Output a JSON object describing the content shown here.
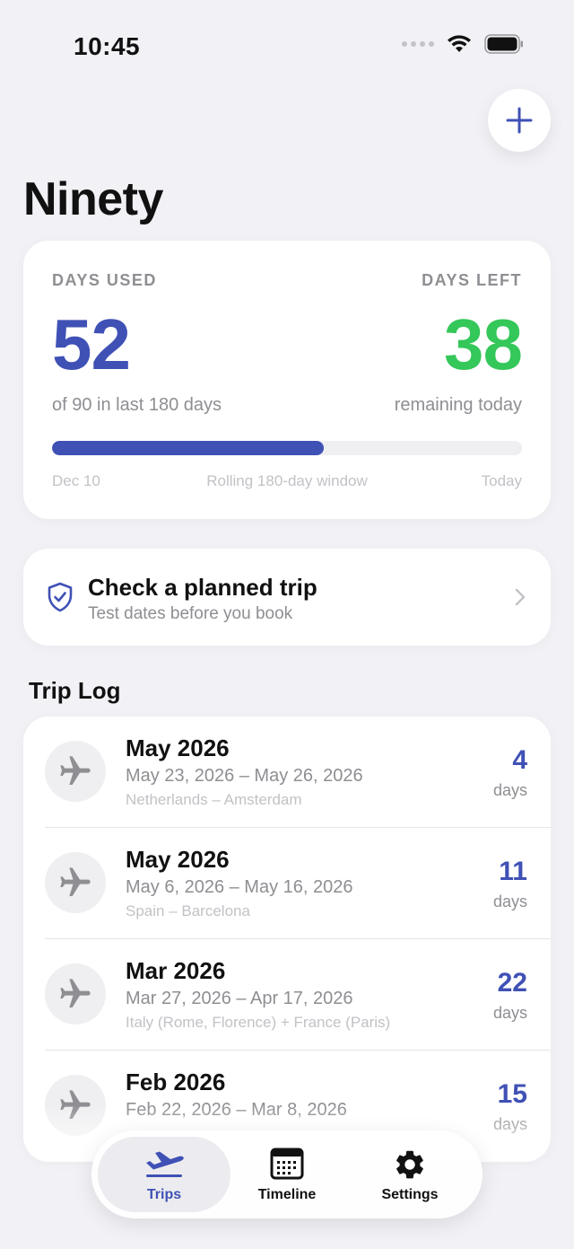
{
  "status": {
    "time": "10:45"
  },
  "header": {
    "title": "Ninety"
  },
  "summary": {
    "days_used_label": "DAYS USED",
    "days_used": "52",
    "days_used_sub": "of 90 in last 180 days",
    "days_left_label": "DAYS LEFT",
    "days_left": "38",
    "days_left_sub": "remaining today",
    "progress_fraction": 0.578,
    "window_start": "Dec 10",
    "window_label": "Rolling 180-day window",
    "window_end": "Today"
  },
  "check": {
    "title": "Check a planned trip",
    "subtitle": "Test dates before you book"
  },
  "trip_log": {
    "title": "Trip Log",
    "days_label": "days",
    "trips": [
      {
        "month": "May 2026",
        "range": "May 23, 2026 – May 26, 2026",
        "place": "Netherlands – Amsterdam",
        "days": "4"
      },
      {
        "month": "May 2026",
        "range": "May 6, 2026 – May 16, 2026",
        "place": "Spain – Barcelona",
        "days": "11"
      },
      {
        "month": "Mar 2026",
        "range": "Mar 27, 2026 – Apr 17, 2026",
        "place": "Italy (Rome, Florence) + France (Paris)",
        "days": "22"
      },
      {
        "month": "Feb 2026",
        "range": "Feb 22, 2026 – Mar 8, 2026",
        "place": "",
        "days": "15"
      }
    ]
  },
  "tabs": [
    {
      "label": "Trips",
      "icon": "airplane-takeoff-icon",
      "active": true
    },
    {
      "label": "Timeline",
      "icon": "calendar-icon",
      "active": false
    },
    {
      "label": "Settings",
      "icon": "gear-icon",
      "active": false
    }
  ],
  "colors": {
    "accent": "#3f51b5",
    "positive": "#34c759",
    "background": "#f2f2f6"
  }
}
